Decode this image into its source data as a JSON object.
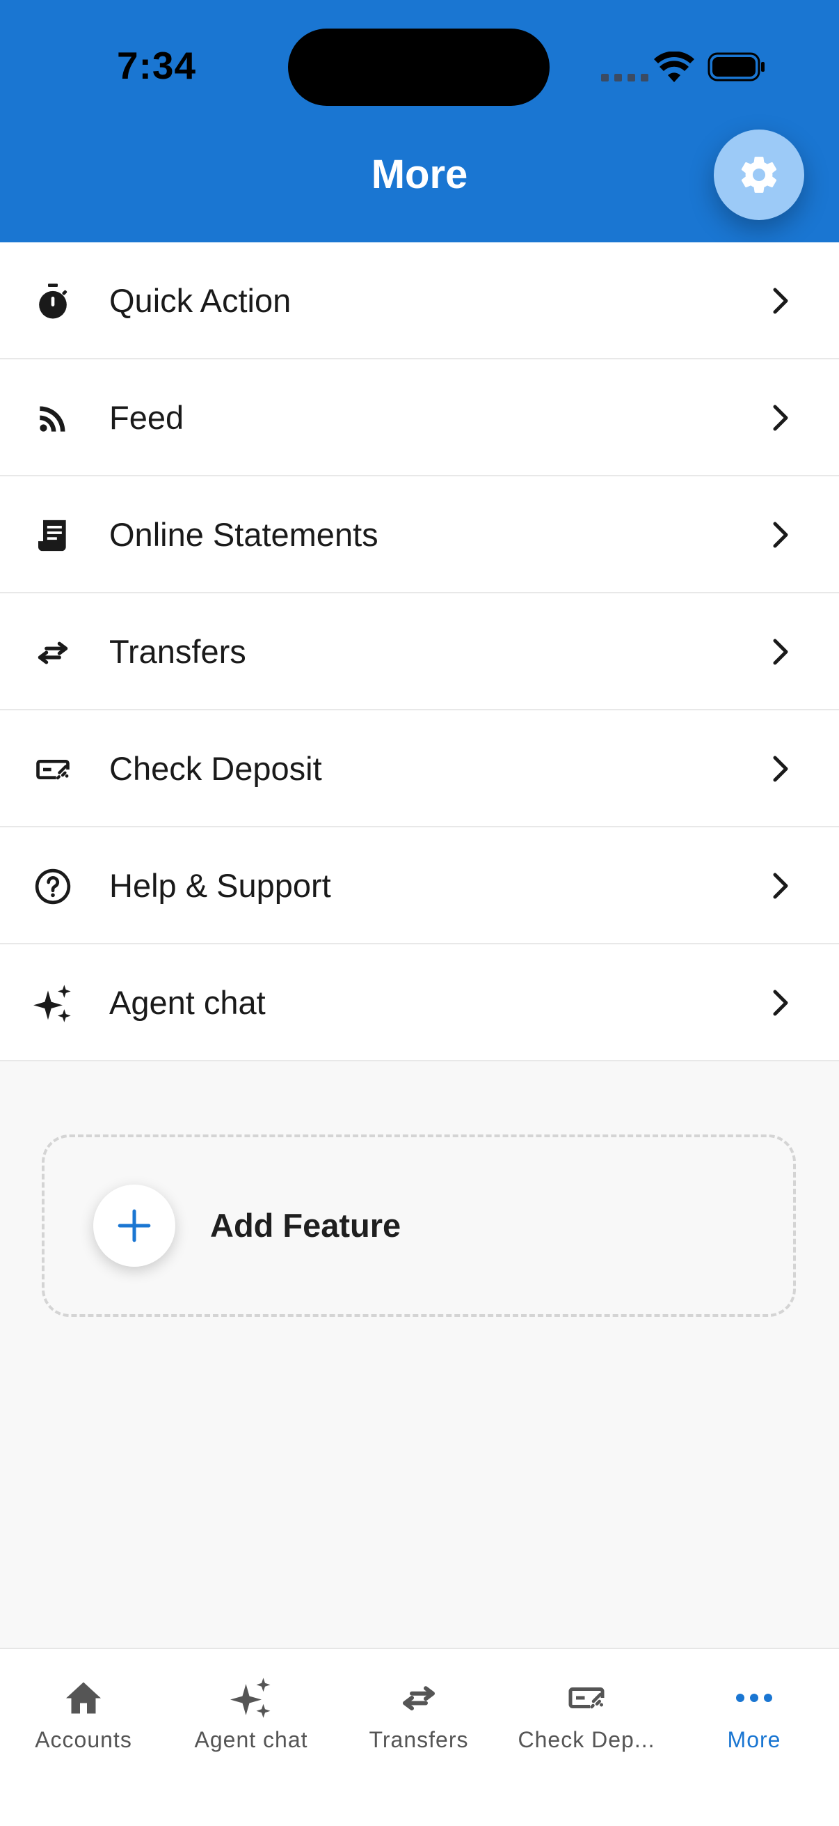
{
  "status_bar": {
    "time": "7:34"
  },
  "header": {
    "title": "More",
    "settings_icon": "gear-icon"
  },
  "menu": {
    "items": [
      {
        "label": "Quick Action",
        "icon": "stopwatch-icon"
      },
      {
        "label": "Feed",
        "icon": "rss-feed-icon"
      },
      {
        "label": "Online Statements",
        "icon": "receipt-icon"
      },
      {
        "label": "Transfers",
        "icon": "transfer-arrows-icon"
      },
      {
        "label": "Check Deposit",
        "icon": "check-deposit-icon"
      },
      {
        "label": "Help & Support",
        "icon": "question-circle-icon"
      },
      {
        "label": "Agent chat",
        "icon": "sparkles-icon"
      }
    ]
  },
  "add_feature": {
    "label": "Add Feature",
    "icon": "plus-icon"
  },
  "tab_bar": {
    "tabs": [
      {
        "label": "Accounts",
        "icon": "home-icon"
      },
      {
        "label": "Agent chat",
        "icon": "sparkles-icon"
      },
      {
        "label": "Transfers",
        "icon": "transfer-arrows-icon"
      },
      {
        "label": "Check Dep...",
        "icon": "check-deposit-icon"
      },
      {
        "label": "More",
        "icon": "more-dots-icon",
        "active": true
      }
    ]
  },
  "colors": {
    "brand_blue": "#1a76d2",
    "settings_button": "#9ccaf7",
    "background": "#f8f8f8"
  }
}
